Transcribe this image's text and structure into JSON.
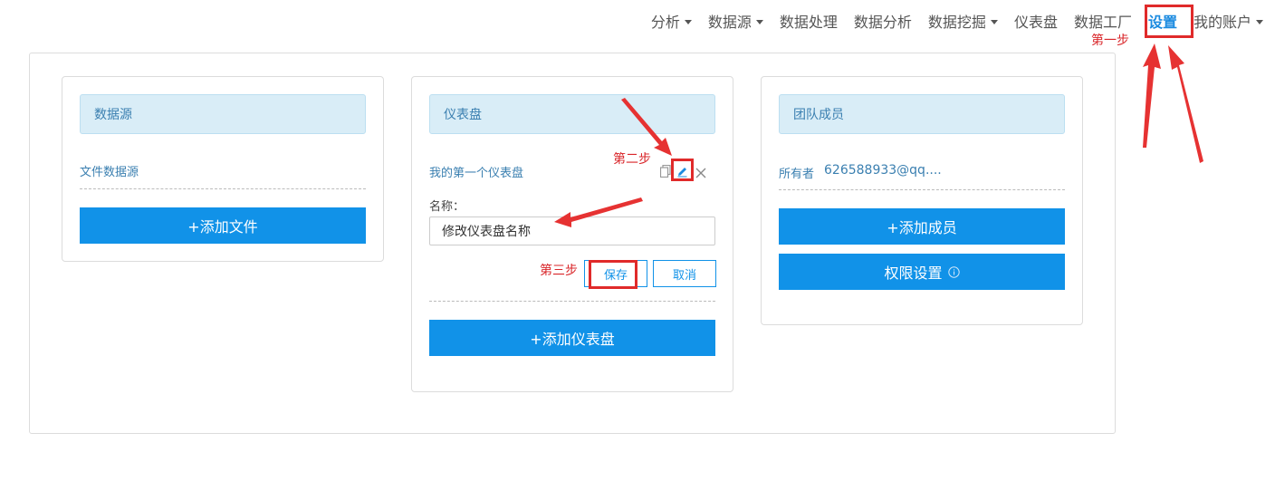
{
  "nav": {
    "items": [
      {
        "label": "分析",
        "caret": true
      },
      {
        "label": "数据源",
        "caret": true
      },
      {
        "label": "数据处理",
        "caret": false
      },
      {
        "label": "数据分析",
        "caret": false
      },
      {
        "label": "数据挖掘",
        "caret": true
      },
      {
        "label": "仪表盘",
        "caret": false
      },
      {
        "label": "数据工厂",
        "caret": false
      },
      {
        "label": "设置",
        "caret": false,
        "active": true
      },
      {
        "label": "我的账户",
        "caret": true
      }
    ]
  },
  "annotations": {
    "step1": "第一步",
    "step2": "第二步",
    "step3": "第三步"
  },
  "datasource_panel": {
    "title": "数据源",
    "item": "文件数据源",
    "add_button": "+添加文件"
  },
  "dashboard_panel": {
    "title": "仪表盘",
    "item": "我的第一个仪表盘",
    "name_label": "名称：",
    "name_value": "修改仪表盘名称",
    "save_button": "保存",
    "cancel_button": "取消",
    "add_button": "+添加仪表盘"
  },
  "team_panel": {
    "title": "团队成员",
    "owner_label": "所有者",
    "owner_email": "626588933@qq....",
    "add_member_button": "+添加成员",
    "permission_button": "权限设置"
  },
  "colors": {
    "primary": "#1192e8",
    "annotation": "#e02a2a",
    "panel_header_bg": "#d9edf7"
  }
}
